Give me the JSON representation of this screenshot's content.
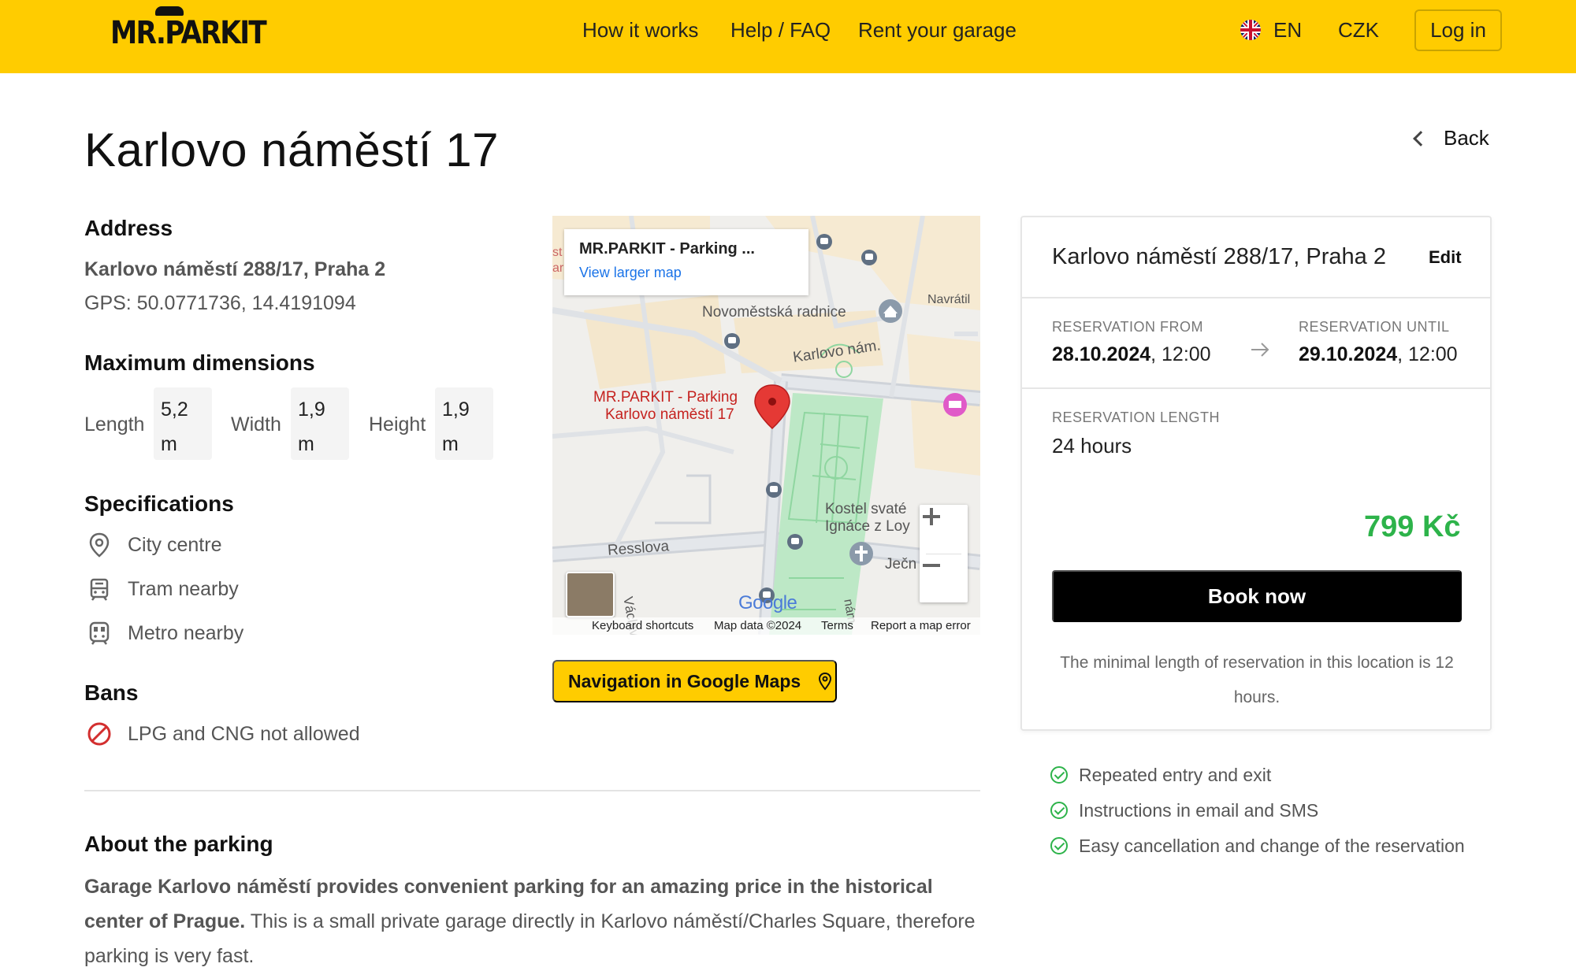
{
  "header": {
    "logo": "MR.PARKIT",
    "nav": [
      "How it works",
      "Help / FAQ",
      "Rent your garage"
    ],
    "language": "EN",
    "currency": "CZK",
    "login_label": "Log in",
    "brand_color": "#ffcc00"
  },
  "page": {
    "title": "Karlovo náměstí 17",
    "back_label": "Back"
  },
  "address": {
    "heading": "Address",
    "street": "Karlovo náměstí 288/17, Praha 2",
    "gps": "GPS: 50.0771736, 14.4191094"
  },
  "dimensions": {
    "heading": "Maximum dimensions",
    "items": [
      {
        "label": "Length",
        "value": "5,2",
        "unit": "m"
      },
      {
        "label": "Width",
        "value": "1,9",
        "unit": "m"
      },
      {
        "label": "Height",
        "value": "1,9",
        "unit": "m"
      }
    ]
  },
  "specifications": {
    "heading": "Specifications",
    "items": [
      {
        "icon": "location-pin-icon",
        "label": "City centre"
      },
      {
        "icon": "tram-icon",
        "label": "Tram nearby"
      },
      {
        "icon": "metro-icon",
        "label": "Metro nearby"
      }
    ]
  },
  "bans": {
    "heading": "Bans",
    "items": [
      {
        "icon": "no-entry-icon",
        "label": "LPG and CNG not allowed"
      }
    ]
  },
  "about": {
    "heading": "About the parking",
    "bold_text": "Garage Karlovo náměstí  provides convenient parking for an amazing price in the historical center of Prague.",
    "text": " This is a small private garage directly in Karlovo náměstí/Charles Square, therefore parking is very fast."
  },
  "map": {
    "card_title": "MR.PARKIT - Parking ...",
    "card_link": "View larger map",
    "marker_label_1": "MR.PARKIT - Parking",
    "marker_label_2": "Karlovo náměstí 17",
    "labels": {
      "radnice": "Novoměstská radnice",
      "karlovo": "Karlovo nám.",
      "navratil": "Navrátil",
      "kostel_1": "Kostel svaté",
      "kostel_2": "Ignáce z Loy",
      "resslova": "Resslova",
      "jecna": "Ječn",
      "vaclav": "Václavs",
      "nam": "nám.",
      "edge_1": "st",
      "edge_2": "ar"
    },
    "google": "Google",
    "footer": [
      "Keyboard shortcuts",
      "Map data ©2024",
      "Terms",
      "Report a map error"
    ],
    "zoom_in": "+",
    "zoom_out": "−",
    "nav_button": "Navigation in Google Maps"
  },
  "booking": {
    "address": "Karlovo náměstí 288/17, Praha 2",
    "edit_label": "Edit",
    "from_label": "RESERVATION FROM",
    "from_date": "28.10.2024",
    "from_time": ", 12:00",
    "until_label": "RESERVATION UNTIL",
    "until_date": "29.10.2024",
    "until_time": ", 12:00",
    "length_label": "RESERVATION LENGTH",
    "length_value": "24 hours",
    "price": "799 Kč",
    "book_label": "Book now",
    "note": "The minimal length of reservation in this location is 12 hours.",
    "price_color": "#2db34a"
  },
  "perks": [
    "Repeated entry and exit",
    "Instructions in email and SMS",
    "Easy cancellation and change of the reservation"
  ]
}
